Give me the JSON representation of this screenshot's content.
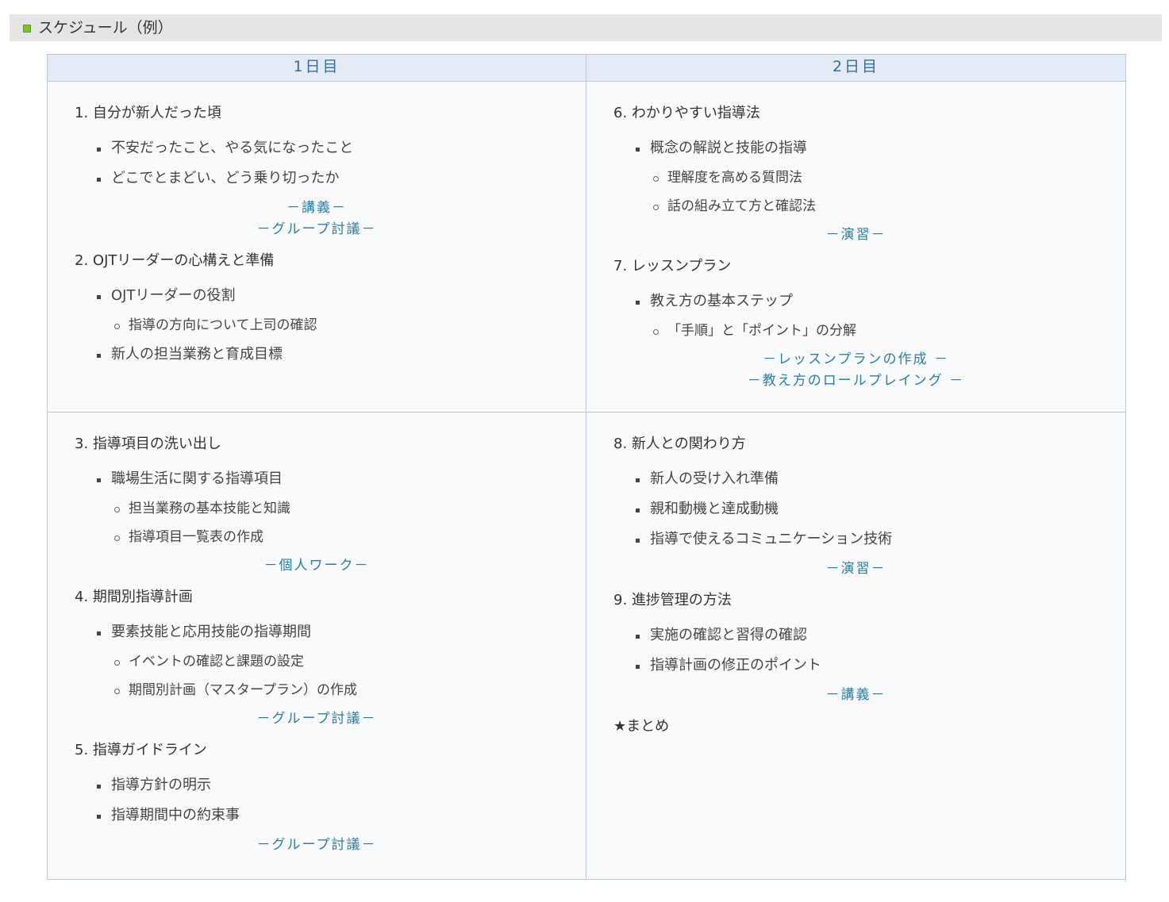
{
  "section": {
    "title": "スケジュール（例）"
  },
  "headers": [
    "1日目",
    "2日目"
  ],
  "day1": {
    "top": {
      "topics": [
        {
          "title": "1. 自分が新人だった頃",
          "bullets": [
            "不安だったこと、やる気になったこと",
            "どこでとまどい、どう乗り切ったか"
          ],
          "methods": [
            "－講義－",
            "－グループ討議－"
          ]
        },
        {
          "title": "2. OJTリーダーの心構えと準備",
          "bullets": [
            "OJTリーダーの役割",
            "新人の担当業務と育成目標"
          ],
          "subs": [
            "指導の方向について上司の確認"
          ]
        }
      ]
    },
    "bottom": {
      "topics": [
        {
          "title": "3. 指導項目の洗い出し",
          "bullets": [
            "職場生活に関する指導項目"
          ],
          "subs": [
            "担当業務の基本技能と知識",
            "指導項目一覧表の作成"
          ],
          "methods": [
            "－個人ワーク－"
          ]
        },
        {
          "title": "4. 期間別指導計画",
          "bullets": [
            "要素技能と応用技能の指導期間"
          ],
          "subs": [
            "イベントの確認と課題の設定",
            "期間別計画（マスタープラン）の作成"
          ],
          "methods": [
            "－グループ討議－"
          ]
        },
        {
          "title": "5. 指導ガイドライン",
          "bullets": [
            "指導方針の明示",
            "指導期間中の約束事"
          ],
          "methods": [
            "－グループ討議－"
          ]
        }
      ]
    }
  },
  "day2": {
    "top": {
      "topics": [
        {
          "title": "6. わかりやすい指導法",
          "bullets": [
            "概念の解説と技能の指導"
          ],
          "subs": [
            "理解度を高める質問法",
            "話の組み立て方と確認法"
          ],
          "methods": [
            "－演習－"
          ]
        },
        {
          "title": "7. レッスンプラン",
          "bullets": [
            "教え方の基本ステップ"
          ],
          "subs": [
            "「手順」と「ポイント」の分解"
          ],
          "methods": [
            "－レッスンプランの作成 －",
            "－教え方のロールプレイング －"
          ]
        }
      ]
    },
    "bottom": {
      "topics": [
        {
          "title": "8. 新人との関わり方",
          "bullets": [
            "新人の受け入れ準備",
            "親和動機と達成動機",
            "指導で使えるコミュニケーション技術"
          ],
          "methods": [
            "－演習－"
          ]
        },
        {
          "title": "9. 進捗管理の方法",
          "bullets": [
            "実施の確認と習得の確認",
            "指導計画の修正のポイント"
          ],
          "methods": [
            "－講義－"
          ]
        },
        {
          "title": "★まとめ"
        }
      ]
    }
  }
}
